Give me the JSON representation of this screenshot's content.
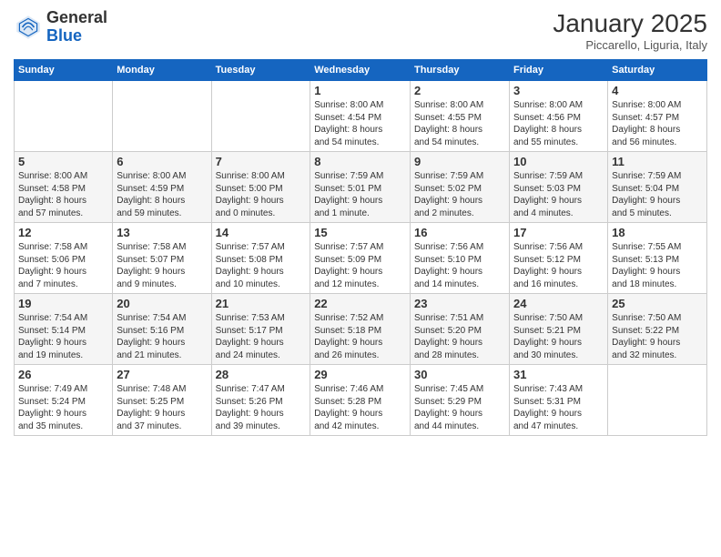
{
  "header": {
    "logo_general": "General",
    "logo_blue": "Blue",
    "month_title": "January 2025",
    "location": "Piccarello, Liguria, Italy"
  },
  "days_of_week": [
    "Sunday",
    "Monday",
    "Tuesday",
    "Wednesday",
    "Thursday",
    "Friday",
    "Saturday"
  ],
  "weeks": [
    [
      {
        "day": "",
        "info": ""
      },
      {
        "day": "",
        "info": ""
      },
      {
        "day": "",
        "info": ""
      },
      {
        "day": "1",
        "info": "Sunrise: 8:00 AM\nSunset: 4:54 PM\nDaylight: 8 hours\nand 54 minutes."
      },
      {
        "day": "2",
        "info": "Sunrise: 8:00 AM\nSunset: 4:55 PM\nDaylight: 8 hours\nand 54 minutes."
      },
      {
        "day": "3",
        "info": "Sunrise: 8:00 AM\nSunset: 4:56 PM\nDaylight: 8 hours\nand 55 minutes."
      },
      {
        "day": "4",
        "info": "Sunrise: 8:00 AM\nSunset: 4:57 PM\nDaylight: 8 hours\nand 56 minutes."
      }
    ],
    [
      {
        "day": "5",
        "info": "Sunrise: 8:00 AM\nSunset: 4:58 PM\nDaylight: 8 hours\nand 57 minutes."
      },
      {
        "day": "6",
        "info": "Sunrise: 8:00 AM\nSunset: 4:59 PM\nDaylight: 8 hours\nand 59 minutes."
      },
      {
        "day": "7",
        "info": "Sunrise: 8:00 AM\nSunset: 5:00 PM\nDaylight: 9 hours\nand 0 minutes."
      },
      {
        "day": "8",
        "info": "Sunrise: 7:59 AM\nSunset: 5:01 PM\nDaylight: 9 hours\nand 1 minute."
      },
      {
        "day": "9",
        "info": "Sunrise: 7:59 AM\nSunset: 5:02 PM\nDaylight: 9 hours\nand 2 minutes."
      },
      {
        "day": "10",
        "info": "Sunrise: 7:59 AM\nSunset: 5:03 PM\nDaylight: 9 hours\nand 4 minutes."
      },
      {
        "day": "11",
        "info": "Sunrise: 7:59 AM\nSunset: 5:04 PM\nDaylight: 9 hours\nand 5 minutes."
      }
    ],
    [
      {
        "day": "12",
        "info": "Sunrise: 7:58 AM\nSunset: 5:06 PM\nDaylight: 9 hours\nand 7 minutes."
      },
      {
        "day": "13",
        "info": "Sunrise: 7:58 AM\nSunset: 5:07 PM\nDaylight: 9 hours\nand 9 minutes."
      },
      {
        "day": "14",
        "info": "Sunrise: 7:57 AM\nSunset: 5:08 PM\nDaylight: 9 hours\nand 10 minutes."
      },
      {
        "day": "15",
        "info": "Sunrise: 7:57 AM\nSunset: 5:09 PM\nDaylight: 9 hours\nand 12 minutes."
      },
      {
        "day": "16",
        "info": "Sunrise: 7:56 AM\nSunset: 5:10 PM\nDaylight: 9 hours\nand 14 minutes."
      },
      {
        "day": "17",
        "info": "Sunrise: 7:56 AM\nSunset: 5:12 PM\nDaylight: 9 hours\nand 16 minutes."
      },
      {
        "day": "18",
        "info": "Sunrise: 7:55 AM\nSunset: 5:13 PM\nDaylight: 9 hours\nand 18 minutes."
      }
    ],
    [
      {
        "day": "19",
        "info": "Sunrise: 7:54 AM\nSunset: 5:14 PM\nDaylight: 9 hours\nand 19 minutes."
      },
      {
        "day": "20",
        "info": "Sunrise: 7:54 AM\nSunset: 5:16 PM\nDaylight: 9 hours\nand 21 minutes."
      },
      {
        "day": "21",
        "info": "Sunrise: 7:53 AM\nSunset: 5:17 PM\nDaylight: 9 hours\nand 24 minutes."
      },
      {
        "day": "22",
        "info": "Sunrise: 7:52 AM\nSunset: 5:18 PM\nDaylight: 9 hours\nand 26 minutes."
      },
      {
        "day": "23",
        "info": "Sunrise: 7:51 AM\nSunset: 5:20 PM\nDaylight: 9 hours\nand 28 minutes."
      },
      {
        "day": "24",
        "info": "Sunrise: 7:50 AM\nSunset: 5:21 PM\nDaylight: 9 hours\nand 30 minutes."
      },
      {
        "day": "25",
        "info": "Sunrise: 7:50 AM\nSunset: 5:22 PM\nDaylight: 9 hours\nand 32 minutes."
      }
    ],
    [
      {
        "day": "26",
        "info": "Sunrise: 7:49 AM\nSunset: 5:24 PM\nDaylight: 9 hours\nand 35 minutes."
      },
      {
        "day": "27",
        "info": "Sunrise: 7:48 AM\nSunset: 5:25 PM\nDaylight: 9 hours\nand 37 minutes."
      },
      {
        "day": "28",
        "info": "Sunrise: 7:47 AM\nSunset: 5:26 PM\nDaylight: 9 hours\nand 39 minutes."
      },
      {
        "day": "29",
        "info": "Sunrise: 7:46 AM\nSunset: 5:28 PM\nDaylight: 9 hours\nand 42 minutes."
      },
      {
        "day": "30",
        "info": "Sunrise: 7:45 AM\nSunset: 5:29 PM\nDaylight: 9 hours\nand 44 minutes."
      },
      {
        "day": "31",
        "info": "Sunrise: 7:43 AM\nSunset: 5:31 PM\nDaylight: 9 hours\nand 47 minutes."
      },
      {
        "day": "",
        "info": ""
      }
    ]
  ]
}
